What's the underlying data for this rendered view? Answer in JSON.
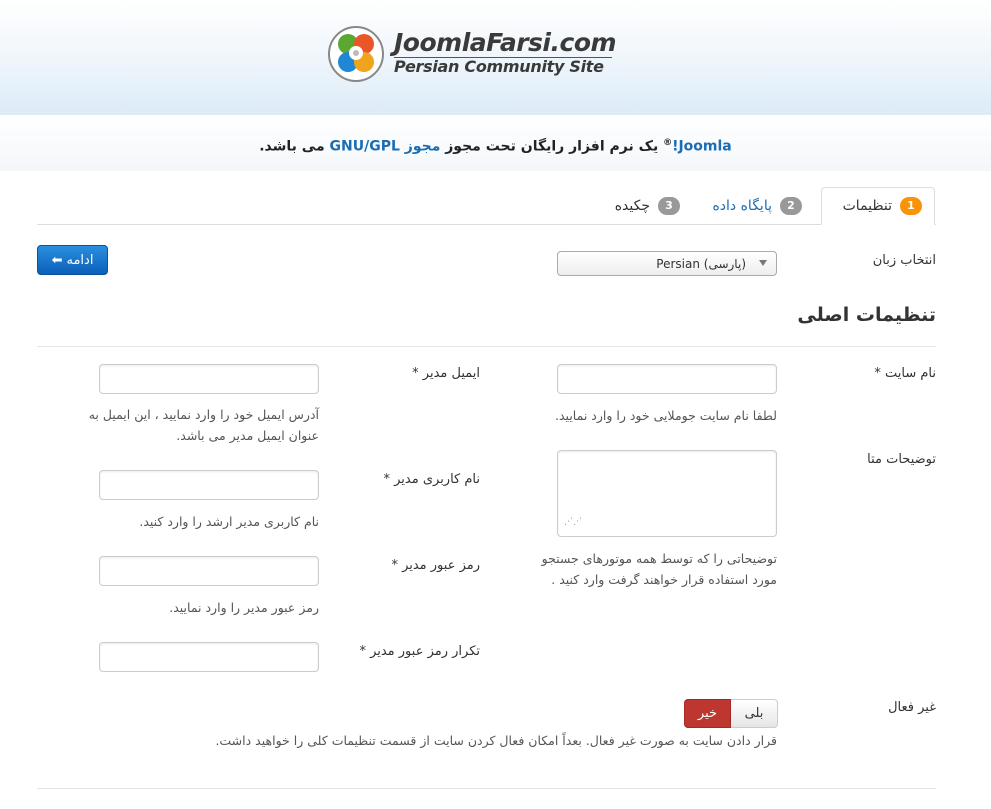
{
  "header": {
    "logo_title": "JoomlaFarsi.com",
    "logo_subtitle": "Persian Community Site"
  },
  "notice": {
    "joomla": "Joomla!",
    "reg": "®",
    "text1": " یک نرم افزار رایگان تحت مجوز ",
    "license_link": "مجوز",
    "gpl": "GNU/GPL",
    "text2": " می باشد."
  },
  "tabs": [
    {
      "num": "1",
      "label": "تنظیمات"
    },
    {
      "num": "2",
      "label": "پایگاه داده"
    },
    {
      "num": "3",
      "label": "چکیده"
    }
  ],
  "toolbar": {
    "next_label": "ادامه"
  },
  "language": {
    "label": "انتخاب زبان",
    "selected": "Persian (پارسی)"
  },
  "section": {
    "title": "تنظیمات اصلی"
  },
  "fields": {
    "site_name": {
      "label": "نام سایت *",
      "help": "لطفا نام سایت جوملایی خود را وارد نمایید."
    },
    "meta_desc": {
      "label": "توضیحات متا",
      "help1": "توضیحاتی را که توسط همه موتورهای جستجو",
      "help2": "مورد استفاده قرار خواهند گرفت وارد کنید ."
    },
    "admin_email": {
      "label": "ایمیل مدیر *",
      "help1": "آدرس ایمیل خود را وارد نمایید ، این ایمیل به",
      "help2": "عنوان ایمیل مدیر می باشد."
    },
    "admin_user": {
      "label": "نام کاربری مدیر *",
      "help": "نام کاربری مدیر ارشد را وارد کنید."
    },
    "admin_pass": {
      "label": "رمز عبور مدیر *",
      "help": "رمز عبور مدیر را وارد نمایید."
    },
    "admin_pass2": {
      "label": "تکرار رمز عبور مدیر *"
    },
    "offline": {
      "label": "غیر فعال",
      "yes": "بلی",
      "no": "خیر",
      "help": "قرار دادن سایت به صورت غیر فعال. بعداً امکان فعال کردن سایت از قسمت تنظیمات کلی را خواهید داشت."
    }
  },
  "colors": {
    "accent": "#1a6db3",
    "badge_active": "#f89406",
    "danger": "#bd362f"
  }
}
